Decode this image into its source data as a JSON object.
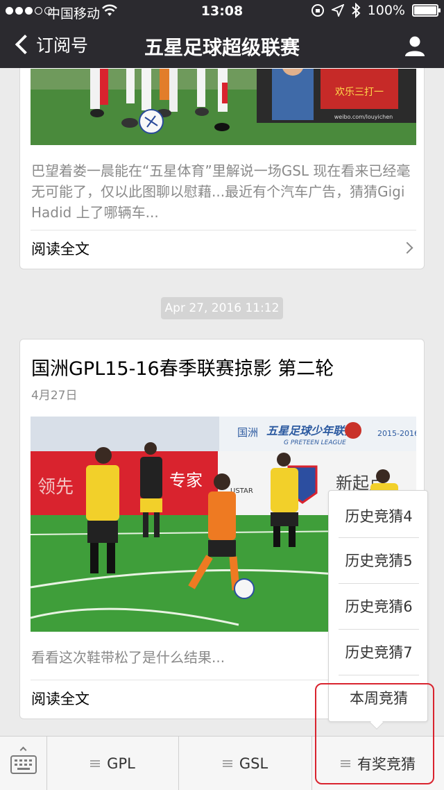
{
  "status_bar": {
    "carrier": "中国移动",
    "time": "13:08",
    "battery": "100%"
  },
  "nav": {
    "back_label": "订阅号",
    "title": "五星足球超级联赛"
  },
  "articles": [
    {
      "excerpt": "巴望着娄一晨能在“五星体育”里解说一场GSL 现在看来已经毫无可能了，仅以此图聊以慰藉...最近有个汽车广告，猜猜Gigi Hadid 上了哪辆车...",
      "read_more": "阅读全文",
      "photo_texts": [
        "欢乐三打一",
        "weibo.com/louyichen"
      ]
    },
    {
      "title": "国洲GPL15-16春季联赛掠影 第二轮",
      "date": "4月27日",
      "excerpt": "看看这次鞋带松了是什么结果...",
      "read_more": "阅读全文",
      "photo_texts": [
        "国洲",
        "五星足球少年联赛",
        "G PRETEEN LEAGUE",
        "2015-2016",
        "领先",
        "专家",
        "新起点",
        "USTAR"
      ]
    }
  ],
  "timestamp": "Apr 27, 2016 11:12",
  "popup_menu": {
    "items": [
      "历史竞猜4",
      "历史竞猜5",
      "历史竞猜6",
      "历史竞猜7",
      "本周竞猜"
    ]
  },
  "bottom_tabs": [
    "GPL",
    "GSL",
    "有奖竞猜"
  ],
  "colors": {
    "nav_bg": "#2b2a2f",
    "highlight": "#d9232e",
    "page_bg": "#ebebeb"
  }
}
